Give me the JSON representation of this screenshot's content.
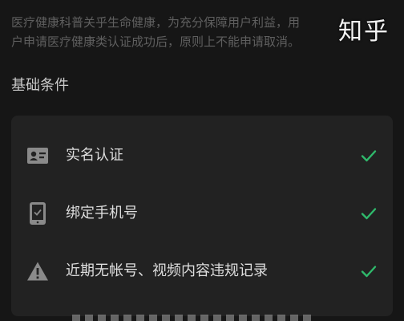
{
  "notice": {
    "line1": "医疗健康科普关乎生命健康，为充分保障用户利益，用",
    "line2": "户申请医疗健康类认证成功后，原则上不能申请取消。"
  },
  "watermark": "知乎",
  "section": {
    "title": "基础条件"
  },
  "conditions": [
    {
      "label": "实名认证",
      "icon": "id-card-icon",
      "status": "check-icon"
    },
    {
      "label": "绑定手机号",
      "icon": "phone-icon",
      "status": "check-icon"
    },
    {
      "label": "近期无帐号、视频内容违规记录",
      "icon": "warning-icon",
      "status": "check-icon"
    }
  ],
  "colors": {
    "background": "#161616",
    "card": "#222222",
    "check": "#2fb96b",
    "icon": "#8a8a8a"
  }
}
